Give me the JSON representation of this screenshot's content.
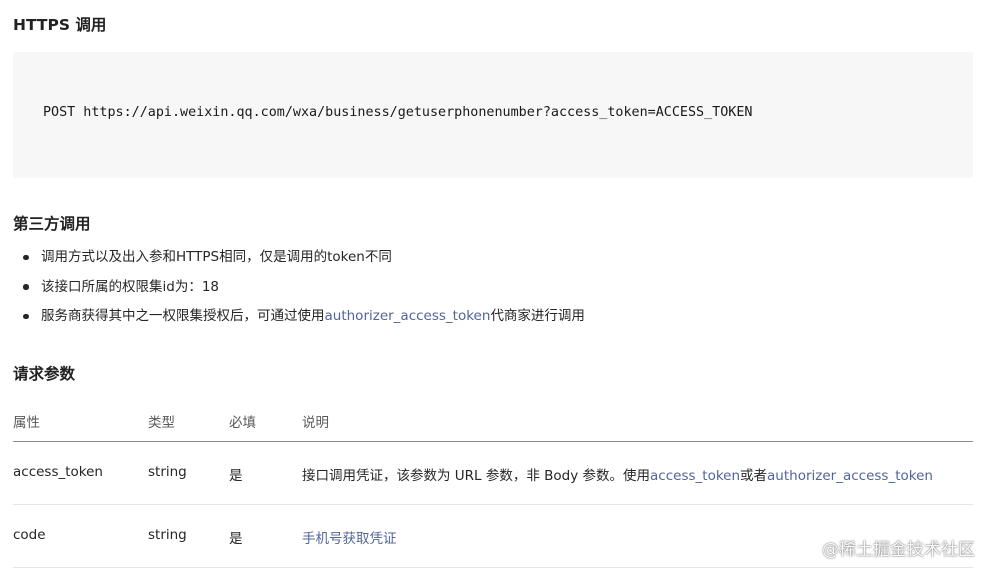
{
  "sections": {
    "https": {
      "heading": "HTTPS 调用",
      "code": "POST https://api.weixin.qq.com/wxa/business/getuserphonenumber?access_token=ACCESS_TOKEN"
    },
    "third_party": {
      "heading": "第三方调用",
      "bullets": [
        {
          "text": "调用方式以及出入参和HTTPS相同，仅是调用的token不同"
        },
        {
          "text": "该接口所属的权限集id为：18"
        },
        {
          "before": "服务商获得其中之一权限集授权后，可通过使用",
          "link": "authorizer_access_token",
          "after": "代商家进行调用"
        }
      ]
    },
    "params": {
      "heading": "请求参数",
      "columns": [
        "属性",
        "类型",
        "必填",
        "说明"
      ],
      "rows": [
        {
          "name": "access_token",
          "type": "string",
          "required": "是",
          "desc_before": "接口调用凭证，该参数为 URL 参数，非 Body 参数。使用",
          "desc_link1": "access_token",
          "desc_mid": "或者",
          "desc_link2": "authorizer_access_token"
        },
        {
          "name": "code",
          "type": "string",
          "required": "是",
          "desc_link1": "手机号获取凭证"
        }
      ]
    }
  },
  "watermark": "@稀土掘金技术社区",
  "colors": {
    "link": "#516599",
    "code_bg": "#f7f7f7",
    "text": "#262626"
  }
}
